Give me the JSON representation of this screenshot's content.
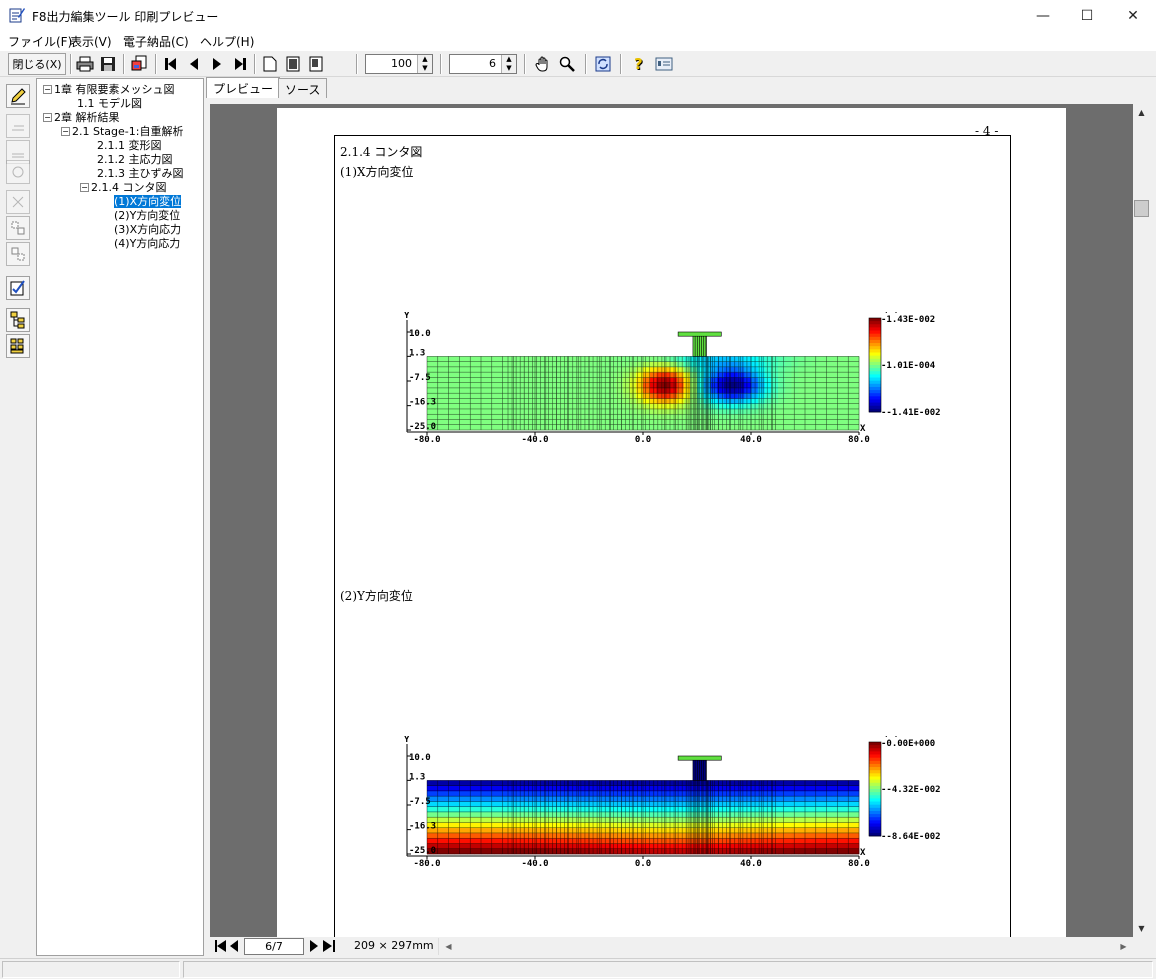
{
  "window": {
    "title": "F8出力編集ツール 印刷プレビュー",
    "minimize": "—",
    "maximize": "☐",
    "close": "✕"
  },
  "menu": [
    "ファイル(F)",
    "表示(V)",
    "電子納品(C)",
    "ヘルプ(H)"
  ],
  "toolbar": {
    "close_label": "閉じる(X)",
    "zoom_value": "100",
    "page_count_value": "6"
  },
  "tree": [
    {
      "label": "1章 有限要素メッシュ図",
      "exp": "−"
    },
    {
      "label": "1.1 モデル図"
    },
    {
      "label": "2章 解析結果",
      "exp": "−"
    },
    {
      "label": "2.1 Stage-1:自重解析",
      "exp": "−"
    },
    {
      "label": "2.1.1 変形図"
    },
    {
      "label": "2.1.2 主応力図"
    },
    {
      "label": "2.1.3 主ひずみ図"
    },
    {
      "label": "2.1.4 コンタ図",
      "exp": "−"
    },
    {
      "label": "(1)X方向変位"
    },
    {
      "label": "(2)Y方向変位"
    },
    {
      "label": "(3)X方向応力"
    },
    {
      "label": "(4)Y方向応力"
    }
  ],
  "tabs": [
    "プレビュー",
    "ソース"
  ],
  "page": {
    "page_no": "- 4 -",
    "section": "2.1.4 コンタ図",
    "fig1_title": "(1)X方向変位",
    "fig2_title": "(2)Y方向変位"
  },
  "chart_data": [
    {
      "type": "heatmap",
      "title": "(1)X方向変位",
      "unit": "(m)",
      "y_axis_label": "Y",
      "x_axis_label": "X",
      "y_ticks": [
        "10.0",
        "1.3",
        "-7.5",
        "-16.3",
        "-25.0"
      ],
      "x_ticks": [
        "-80.0",
        "-40.0",
        "0.0",
        "40.0",
        "80.0"
      ],
      "colorbar": [
        "1.43E-002",
        "1.01E-004",
        "-1.41E-002"
      ],
      "xlim": [
        -80,
        80
      ],
      "ylim": [
        -25,
        10
      ]
    },
    {
      "type": "heatmap",
      "title": "(2)Y方向変位",
      "unit": "(m)",
      "y_axis_label": "Y",
      "x_axis_label": "X",
      "y_ticks": [
        "10.0",
        "1.3",
        "-7.5",
        "-16.3",
        "-25.0"
      ],
      "x_ticks": [
        "-80.0",
        "-40.0",
        "0.0",
        "40.0",
        "80.0"
      ],
      "colorbar": [
        "0.00E+000",
        "-4.32E-002",
        "-8.64E-002"
      ],
      "xlim": [
        -80,
        80
      ],
      "ylim": [
        -25,
        10
      ]
    }
  ],
  "bottom": {
    "page_field": "6/7",
    "paper_size": "209 × 297mm"
  },
  "colors": {
    "selection": "#0078d7",
    "preview_bg": "#6d6d6d"
  }
}
